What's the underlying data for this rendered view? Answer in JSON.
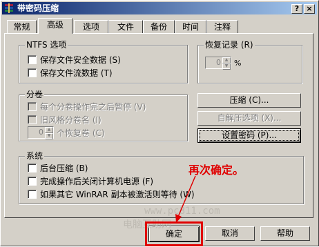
{
  "window": {
    "title": "带密码压缩",
    "help_label": "?",
    "close_label": "×"
  },
  "tabs": [
    {
      "label": "常规"
    },
    {
      "label": "高级"
    },
    {
      "label": "选项"
    },
    {
      "label": "文件"
    },
    {
      "label": "备份"
    },
    {
      "label": "时间"
    },
    {
      "label": "注释"
    }
  ],
  "ntfs": {
    "title": "NTFS 选项",
    "options": [
      {
        "label": "保存文件安全数据 (S)",
        "checked": false
      },
      {
        "label": "保存文件流数据 (T)",
        "checked": false
      }
    ]
  },
  "recovery": {
    "title": "恢复记录 (R)",
    "value": "0",
    "unit": "%"
  },
  "volumes": {
    "title": "分卷",
    "options": [
      {
        "label": "每个分卷操作完之后暂停 (V)",
        "checked": false
      },
      {
        "label": "旧风格分卷名 (I)",
        "checked": false
      }
    ],
    "recovery_value": "0",
    "recovery_label": "个恢复卷 (C)"
  },
  "side_buttons": {
    "compress": "压缩 (C)...",
    "sfx": "自解压选项 (X)...",
    "set_password": "设置密码 (P)..."
  },
  "system": {
    "title": "系统",
    "options": [
      {
        "label": "后台压缩 (B)",
        "checked": false
      },
      {
        "label": "完成操作后关闭计算机电源 (F)",
        "checked": false
      },
      {
        "label": "如果其它 WinRAR 副本被激活则等待 (W)",
        "checked": false
      }
    ]
  },
  "dialog_buttons": {
    "ok": "确定",
    "cancel": "取消",
    "help": "帮助"
  },
  "annotation": {
    "text": "再次确定。",
    "color": "#e00000"
  },
  "watermark": {
    "url": "www.pc811.com",
    "site": "电脑互助网"
  }
}
